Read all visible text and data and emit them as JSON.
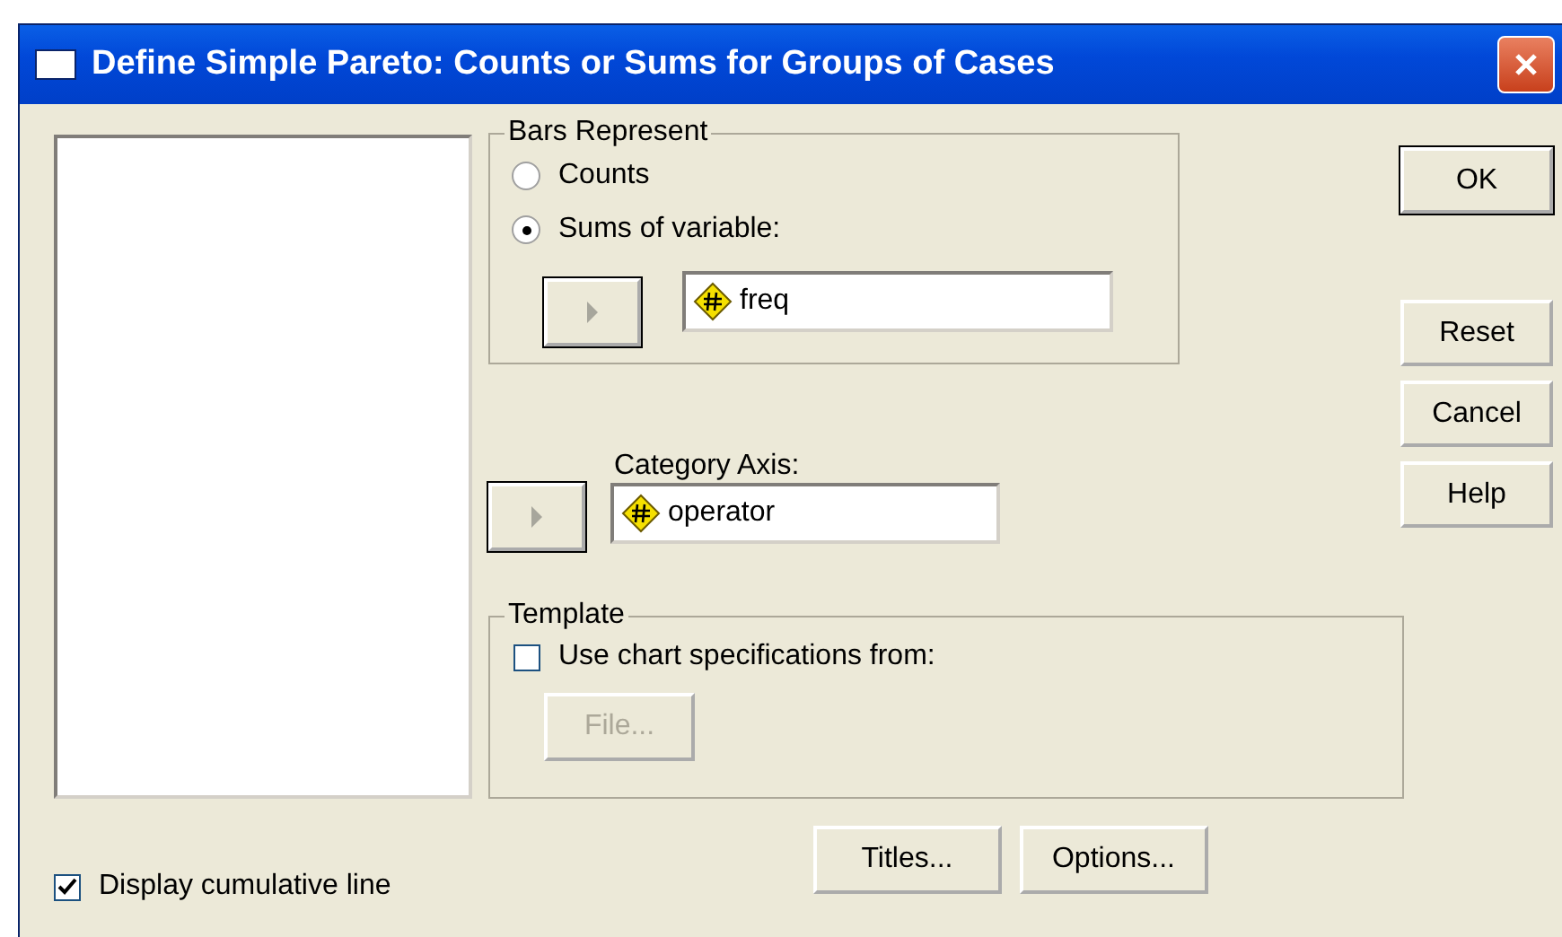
{
  "window": {
    "title": "Define Simple Pareto: Counts or Sums for Groups of Cases"
  },
  "bars_represent": {
    "legend": "Bars Represent",
    "options": [
      {
        "label": "Counts",
        "selected": false
      },
      {
        "label": "Sums of variable:",
        "selected": true
      }
    ],
    "variable": {
      "value": "freq"
    }
  },
  "category_axis": {
    "label": "Category Axis:",
    "value": "operator"
  },
  "template": {
    "legend": "Template",
    "checkbox": {
      "label": "Use chart specifications from:",
      "checked": false
    },
    "file_button": {
      "label": "File...",
      "disabled": true
    }
  },
  "side_buttons": [
    {
      "label": "OK",
      "default": true
    },
    {
      "label": "Reset",
      "default": false
    },
    {
      "label": "Cancel",
      "default": false
    },
    {
      "label": "Help",
      "default": false
    }
  ],
  "display_cumulative_line": {
    "label": "Display cumulative line",
    "checked": true
  },
  "bottom_buttons": [
    "Titles...",
    "Options..."
  ]
}
